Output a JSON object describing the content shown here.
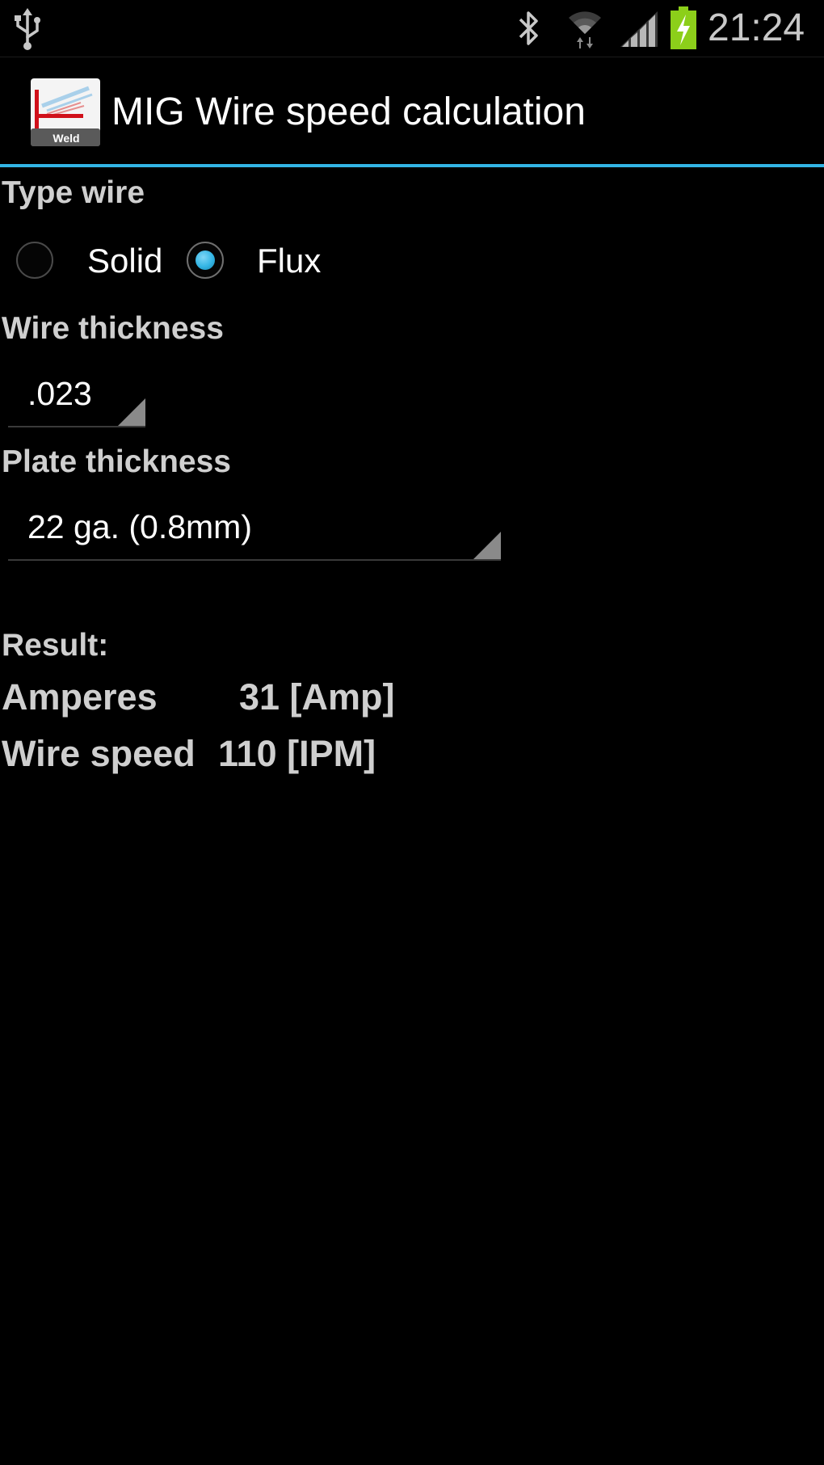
{
  "status_bar": {
    "time": "21:24",
    "icons": [
      "usb-icon",
      "bluetooth-icon",
      "wifi-icon",
      "signal-icon",
      "battery-charging-icon"
    ],
    "battery_color": "#8ccf1a"
  },
  "action_bar": {
    "title": "MIG Wire speed calculation",
    "app_icon_label": "Weld",
    "accent_color": "#33b5e5"
  },
  "type_wire": {
    "label": "Type wire",
    "options": [
      {
        "label": "Solid",
        "checked": false
      },
      {
        "label": "Flux",
        "checked": true
      }
    ]
  },
  "wire_thickness": {
    "label": "Wire thickness",
    "selected": ".023"
  },
  "plate_thickness": {
    "label": "Plate thickness",
    "selected": "22 ga. (0.8mm)"
  },
  "result": {
    "label": "Result:",
    "amperes_label": "Amperes",
    "amperes_value": "31 [Amp]",
    "wire_speed_label": "Wire speed",
    "wire_speed_value": "110 [IPM]"
  }
}
